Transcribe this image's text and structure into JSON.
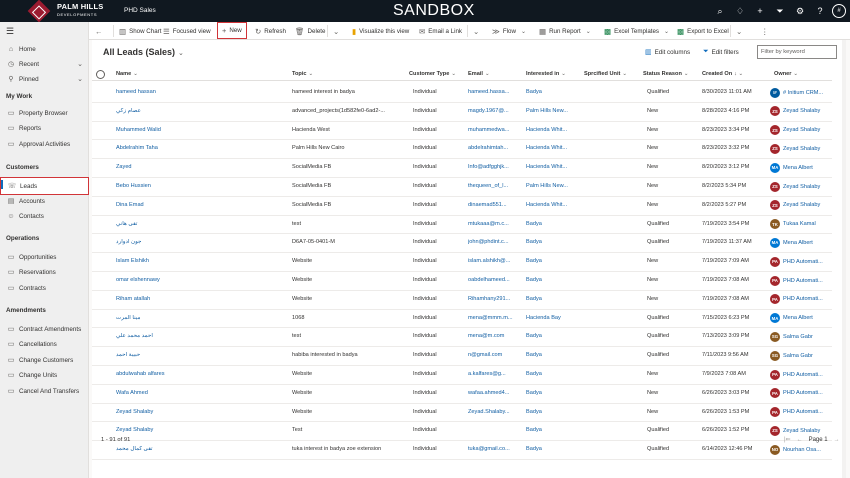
{
  "topbar": {
    "brand": "PALM HILLS",
    "brand_sub": "DEVELOPMENTS",
    "app_name": "PHD Sales",
    "environment": "SANDBOX",
    "user_initial": "#"
  },
  "sidebar": {
    "items": [
      {
        "label": "Home",
        "icon": "home-icon"
      },
      {
        "label": "Recent",
        "icon": "clock-icon"
      },
      {
        "label": "Pinned",
        "icon": "pin-icon"
      }
    ],
    "groups": [
      {
        "title": "My Work",
        "items": [
          "Property Browser",
          "Reports",
          "Approval Activities"
        ]
      },
      {
        "title": "Customers",
        "items": [
          "Leads",
          "Accounts",
          "Contacts"
        ]
      },
      {
        "title": "Operations",
        "items": [
          "Opportunities",
          "Reservations",
          "Contracts"
        ]
      },
      {
        "title": "Amendments",
        "items": [
          "Contract Amendments",
          "Cancellations",
          "Change Customers",
          "Change Units",
          "Cancel And Transfers"
        ]
      }
    ],
    "active": "Leads"
  },
  "commands": {
    "show_chart": "Show Chart",
    "focused_view": "Focused view",
    "new": "New",
    "refresh": "Refresh",
    "delete": "Delete",
    "visualize": "Visualize this view",
    "email_link": "Email a Link",
    "flow": "Flow",
    "run_report": "Run Report",
    "excel_templates": "Excel Templates",
    "export_excel": "Export to Excel"
  },
  "view": {
    "title": "All Leads (Sales)",
    "edit_columns": "Edit columns",
    "edit_filters": "Edit filters",
    "filter_placeholder": "Filter by keyword"
  },
  "columns": [
    "Name",
    "Topic",
    "Customer Type",
    "Email",
    "Interested in",
    "Sprcified Unit",
    "Status Reason",
    "Created On",
    "Owner"
  ],
  "rows": [
    {
      "name": "hameed hassan",
      "topic": "hameed interest in badya",
      "ctype": "Individual",
      "email": "hameed.hassa...",
      "interest": "Badya",
      "status": "Qualified",
      "created": "8/30/2023 11:01 AM",
      "owner": "# Initium CRM...",
      "initials": "I#",
      "color": "#005a9e"
    },
    {
      "name": "عصام زكي",
      "topic": "advanced_projects(1d582fe0-6ad2-...",
      "ctype": "Individual",
      "email": "magdy.1967@...",
      "interest": "Palm Hills New...",
      "status": "New",
      "created": "8/28/2023 4:16 PM",
      "owner": "Zeyad Shalaby",
      "initials": "ZS",
      "color": "#a4262c"
    },
    {
      "name": "Muhammed Walid",
      "topic": "Hacienda West",
      "ctype": "Individual",
      "email": "muhammedwa...",
      "interest": "Hacienda Whit...",
      "status": "New",
      "created": "8/23/2023 3:34 PM",
      "owner": "Zeyad Shalaby",
      "initials": "ZS",
      "color": "#a4262c"
    },
    {
      "name": "Abdelrahim Taha",
      "topic": "Palm Hills New Cairo",
      "ctype": "Individual",
      "email": "abdelrahimtah...",
      "interest": "Hacienda Whit...",
      "status": "New",
      "created": "8/23/2023 3:32 PM",
      "owner": "Zeyad Shalaby",
      "initials": "ZS",
      "color": "#a4262c"
    },
    {
      "name": "Zayed",
      "topic": "SocialMedia FB",
      "ctype": "Individual",
      "email": "Info@adfgghjk...",
      "interest": "Hacienda Whit...",
      "status": "New",
      "created": "8/20/2023 3:12 PM",
      "owner": "Mena Albert",
      "initials": "MA",
      "color": "#0078d4"
    },
    {
      "name": "Bebo Hussien",
      "topic": "SocialMedia FB",
      "ctype": "Individual",
      "email": "thequeen_of_l...",
      "interest": "Palm Hills New...",
      "status": "New",
      "created": "8/2/2023 5:34 PM",
      "owner": "Zeyad Shalaby",
      "initials": "ZS",
      "color": "#a4262c"
    },
    {
      "name": "Dina Emad",
      "topic": "SocialMedia FB",
      "ctype": "Individual",
      "email": "dinaemad551...",
      "interest": "Hacienda Whit...",
      "status": "New",
      "created": "8/2/2023 5:27 PM",
      "owner": "Zeyad Shalaby",
      "initials": "ZS",
      "color": "#a4262c"
    },
    {
      "name": "تقى هاني",
      "topic": "test",
      "ctype": "Individual",
      "email": "mtukaaa@m.c...",
      "interest": "Badya",
      "status": "Qualified",
      "created": "7/19/2023 3:54 PM",
      "owner": "Tukaa Kamal",
      "initials": "TK",
      "color": "#8a5a22"
    },
    {
      "name": "جون ادوارد",
      "topic": "D6A7-05-0401-M",
      "ctype": "Individual",
      "email": "john@phdint.c...",
      "interest": "Badya",
      "status": "Qualified",
      "created": "7/19/2023 11:37 AM",
      "owner": "Mena Albert",
      "initials": "MA",
      "color": "#0078d4"
    },
    {
      "name": "Islam Elshikh",
      "topic": "Website",
      "ctype": "Individual",
      "email": "islam.alshikh@...",
      "interest": "Badya",
      "status": "New",
      "created": "7/19/2023 7:09 AM",
      "owner": "PHD Automati...",
      "initials": "PA",
      "color": "#a4262c"
    },
    {
      "name": "omar elshennawy",
      "topic": "Website",
      "ctype": "Individual",
      "email": "oabdelhameed...",
      "interest": "Badya",
      "status": "New",
      "created": "7/19/2023 7:08 AM",
      "owner": "PHD Automati...",
      "initials": "PA",
      "color": "#a4262c"
    },
    {
      "name": "Riham atallah",
      "topic": "Website",
      "ctype": "Individual",
      "email": "Rihamhany291...",
      "interest": "Badya",
      "status": "New",
      "created": "7/19/2023 7:08 AM",
      "owner": "PHD Automati...",
      "initials": "PA",
      "color": "#a4262c"
    },
    {
      "name": "مينا المرت",
      "topic": "1068",
      "ctype": "Individual",
      "email": "mena@mmm.m...",
      "interest": "Hacienda Bay",
      "status": "Qualified",
      "created": "7/15/2023 6:23 PM",
      "owner": "Mena Albert",
      "initials": "MA",
      "color": "#0078d4"
    },
    {
      "name": "احمد محمد علي",
      "topic": "test",
      "ctype": "Individual",
      "email": "mena@m.com",
      "interest": "Badya",
      "status": "Qualified",
      "created": "7/13/2023 3:09 PM",
      "owner": "Salma Gabr",
      "initials": "SG",
      "color": "#8a5a22"
    },
    {
      "name": "حبيبة احمد",
      "topic": "habiba interested in badya",
      "ctype": "Individual",
      "email": "n@gmail.com",
      "interest": "Badya",
      "status": "Qualified",
      "created": "7/11/2023 9:56 AM",
      "owner": "Salma Gabr",
      "initials": "SG",
      "color": "#8a5a22"
    },
    {
      "name": "abdulwahab alfares",
      "topic": "Website",
      "ctype": "Individual",
      "email": "a.kalfares@g...",
      "interest": "Badya",
      "status": "New",
      "created": "7/9/2023 7:08 AM",
      "owner": "PHD Automati...",
      "initials": "PA",
      "color": "#a4262c"
    },
    {
      "name": "Wafa Ahmed",
      "topic": "Website",
      "ctype": "Individual",
      "email": "wafaa.ahmed4...",
      "interest": "Badya",
      "status": "New",
      "created": "6/26/2023 3:03 PM",
      "owner": "PHD Automati...",
      "initials": "PA",
      "color": "#a4262c"
    },
    {
      "name": "Zeyad Shalaby",
      "topic": "Website",
      "ctype": "Individual",
      "email": "Zeyad.Shalaby...",
      "interest": "Badya",
      "status": "New",
      "created": "6/26/2023 1:53 PM",
      "owner": "PHD Automati...",
      "initials": "PA",
      "color": "#a4262c"
    },
    {
      "name": "Zeyad Shalaby",
      "topic": "Test",
      "ctype": "Individual",
      "email": "",
      "interest": "Badya",
      "status": "Qualified",
      "created": "6/26/2023 1:52 PM",
      "owner": "Zeyad Shalaby",
      "initials": "ZS",
      "color": "#a4262c"
    },
    {
      "name": "تقى كمال محمد",
      "topic": "tuka interest in badya zoe extension",
      "ctype": "Individual",
      "email": "tuka@gmail.co...",
      "interest": "Badya",
      "status": "Qualified",
      "created": "6/14/2023 12:46 PM",
      "owner": "Nourhan Osa...",
      "initials": "NO",
      "color": "#8a5a22"
    }
  ],
  "footer": {
    "record_count": "1 - 91 of 91",
    "page": "Page 1"
  }
}
